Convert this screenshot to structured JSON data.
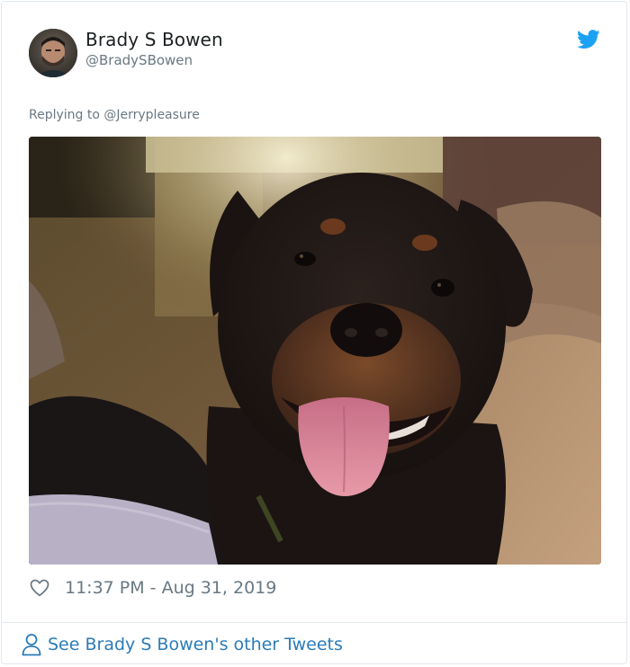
{
  "tweet": {
    "author": {
      "display_name": "Brady S Bowen",
      "handle": "@BradySBowen"
    },
    "replying_to": "Replying to @Jerrypleasure",
    "timestamp": "11:37 PM - Aug 31, 2019",
    "icons": {
      "brand": "twitter-bird-icon",
      "like": "heart-icon",
      "profile": "person-icon"
    },
    "colors": {
      "brand_blue": "#1da1f2",
      "link_blue": "#2b7bb9",
      "secondary_text": "#697882"
    }
  },
  "footer": {
    "link_label": "See Brady S Bowen's other Tweets"
  }
}
